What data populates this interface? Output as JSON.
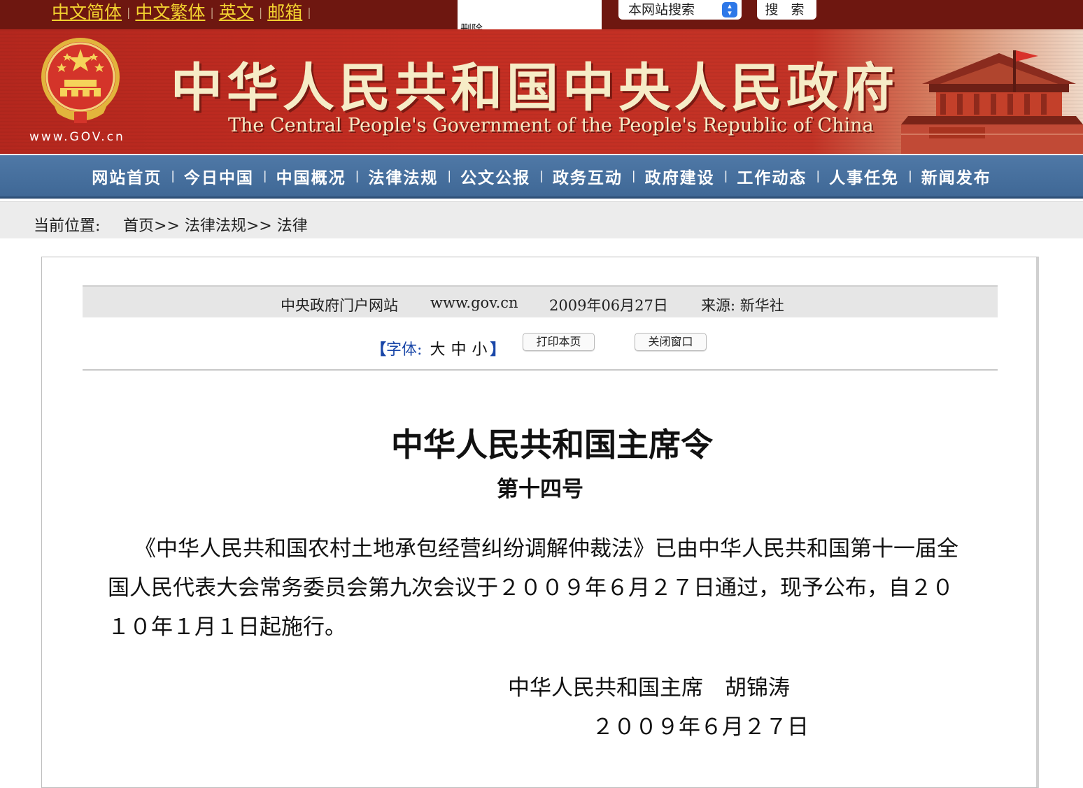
{
  "topbar": {
    "languages": [
      "中文简体",
      "中文繁体",
      "英文",
      "邮箱"
    ],
    "partial_text": "删除",
    "search_scope": "本网站搜索",
    "search_button": "搜 索"
  },
  "banner": {
    "site_url": "www.GOV.cn",
    "title_cn": "中华人民共和国中央人民政府",
    "title_en": "The Central People's Government of the People's Republic of China"
  },
  "nav": {
    "items": [
      "网站首页",
      "今日中国",
      "中国概况",
      "法律法规",
      "公文公报",
      "政务互动",
      "政府建设",
      "工作动态",
      "人事任免",
      "新闻发布"
    ],
    "separator": "|"
  },
  "breadcrumb": {
    "label": "当前位置:",
    "path": "首页>> 法律法规>> 法律"
  },
  "info": {
    "portal": "中央政府门户网站",
    "url": "www.gov.cn",
    "date": "2009年06月27日",
    "source": "来源: 新华社"
  },
  "tools": {
    "bracket_open": "【",
    "font_label": "字体:",
    "sizes": [
      "大",
      "中",
      "小"
    ],
    "bracket_close": "】",
    "print_button": "打印本页",
    "close_button": "关闭窗口"
  },
  "document": {
    "title": "中华人民共和国主席令",
    "number": "第十四号",
    "body": "《中华人民共和国农村土地承包经营纠纷调解仲裁法》已由中华人民共和国第十一届全国人民代表大会常务委员会第九次会议于２００９年６月２７日通过，现予公布，自２０１０年１月１日起施行。",
    "signatory": "中华人民共和国主席　胡锦涛",
    "sign_date": "２００９年６月２７日"
  },
  "colors": {
    "topbar": "#6e1710",
    "language_link": "#f3d230",
    "banner_red": "#c42e22",
    "nav_blue": "#4f78a6",
    "font_control_blue": "#1a47a8"
  }
}
